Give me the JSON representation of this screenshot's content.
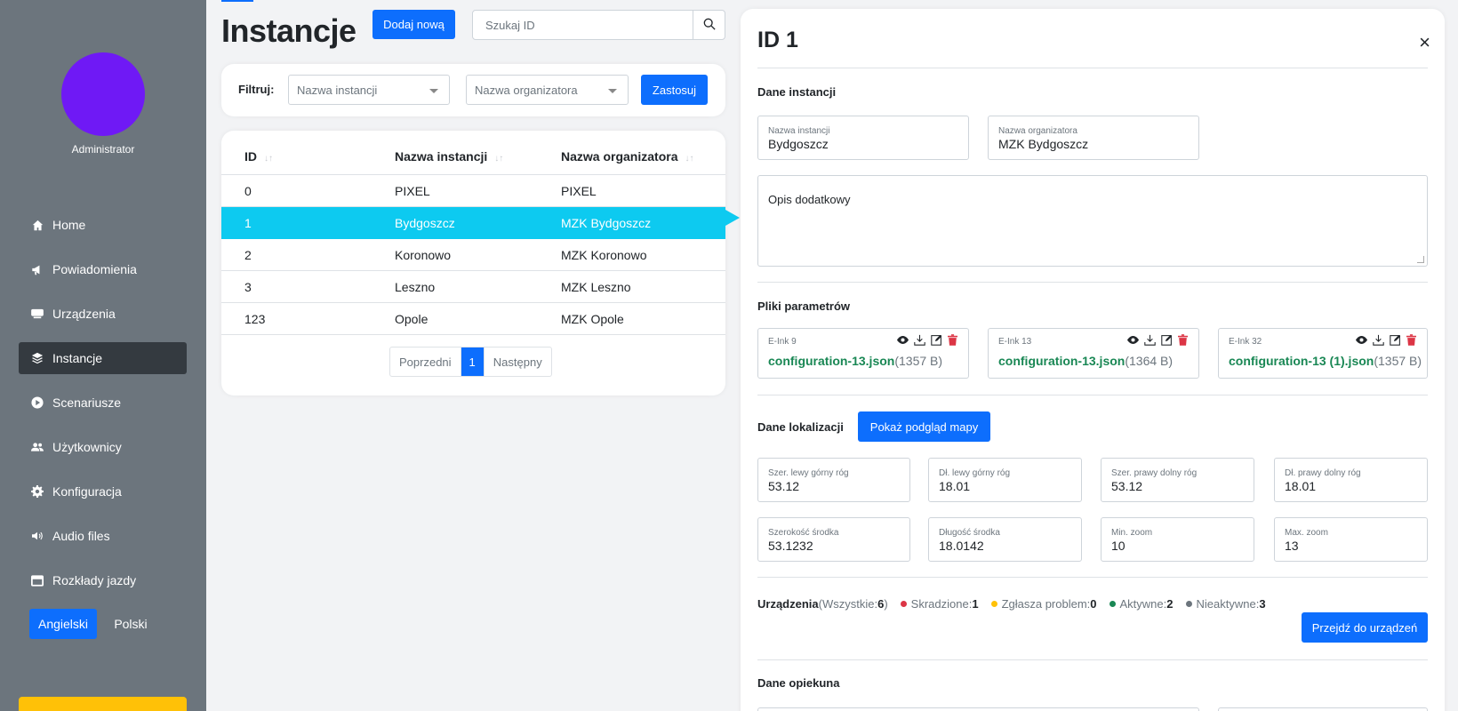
{
  "sidebar": {
    "role": "Administrator",
    "items": [
      {
        "label": "Home",
        "icon": "home-icon"
      },
      {
        "label": "Powiadomienia",
        "icon": "megaphone-icon"
      },
      {
        "label": "Urządzenia",
        "icon": "monitor-icon"
      },
      {
        "label": "Instancje",
        "icon": "layers-icon"
      },
      {
        "label": "Scenariusze",
        "icon": "play-circle-icon"
      },
      {
        "label": "Użytkownicy",
        "icon": "users-icon"
      },
      {
        "label": "Konfiguracja",
        "icon": "gear-icon"
      },
      {
        "label": "Audio files",
        "icon": "speaker-icon"
      },
      {
        "label": "Rozkłady jazdy",
        "icon": "schedule-icon"
      }
    ],
    "active_item": "Instancje",
    "lang_en": "Angielski",
    "lang_pl": "Polski",
    "avatar_color": "#6f19f5"
  },
  "header": {
    "title": "Instancje",
    "add_button": "Dodaj nową",
    "search_placeholder": "Szukaj ID"
  },
  "filter": {
    "label": "Filtruj:",
    "instance_placeholder": "Nazwa instancji",
    "organizer_placeholder": "Nazwa organizatora",
    "apply_button": "Zastosuj"
  },
  "table": {
    "headers": [
      "ID",
      "Nazwa instancji",
      "Nazwa organizatora"
    ],
    "rows": [
      {
        "id": "0",
        "name": "PIXEL",
        "org": "PIXEL"
      },
      {
        "id": "1",
        "name": "Bydgoszcz",
        "org": "MZK Bydgoszcz"
      },
      {
        "id": "2",
        "name": "Koronowo",
        "org": "MZK Koronowo"
      },
      {
        "id": "3",
        "name": "Leszno",
        "org": "MZK Leszno"
      },
      {
        "id": "123",
        "name": "Opole",
        "org": "MZK Opole"
      }
    ],
    "selected_row": 1,
    "pager": {
      "prev": "Poprzedni",
      "current": "1",
      "next": "Następny"
    }
  },
  "detail": {
    "title": "ID 1",
    "close": "×",
    "instance_section": "Dane instancji",
    "instance_name_label": "Nazwa instancji",
    "instance_name": "Bydgoszcz",
    "organizer_label": "Nazwa organizatora",
    "organizer": "MZK Bydgoszcz",
    "description_placeholder": "Opis dodatkowy",
    "files_section": "Pliki parametrów",
    "files": [
      {
        "device": "E-Ink 9",
        "file": "configuration-13.json",
        "size": "(1357 B)"
      },
      {
        "device": "E-Ink 13",
        "file": "configuration-13.json",
        "size": "(1364 B)"
      },
      {
        "device": "E-Ink 32",
        "file": "configuration-13 (1).json",
        "size": "(1357 B)"
      }
    ],
    "location_section": "Dane lokalizacji",
    "map_button": "Pokaż podgląd mapy",
    "location_fields": [
      {
        "label": "Szer. lewy górny róg",
        "value": "53.12"
      },
      {
        "label": "Dł. lewy górny róg",
        "value": "18.01"
      },
      {
        "label": "Szer. prawy dolny róg",
        "value": "53.12"
      },
      {
        "label": "Dł. prawy dolny róg",
        "value": "18.01"
      },
      {
        "label": "Szerokość środka",
        "value": "53.1232"
      },
      {
        "label": "Długość środka",
        "value": "18.0142"
      },
      {
        "label": "Min. zoom",
        "value": "10"
      },
      {
        "label": "Max. zoom",
        "value": "13"
      }
    ],
    "devices": {
      "title": "Urządzenia",
      "all_label": "(Wszystkie: ",
      "all_count": "6",
      "all_close": ")",
      "stolen_label": "Skradzione: ",
      "stolen_count": "1",
      "problem_label": "Zgłasza problem: ",
      "problem_count": "0",
      "active_label": "Aktywne: ",
      "active_count": "2",
      "inactive_label": "Nieaktywne: ",
      "inactive_count": "3",
      "button": "Przejdź do urządzeń",
      "colors": {
        "stolen": "#dc3545",
        "problem": "#ffc107",
        "active": "#198754",
        "inactive": "#6c757d"
      }
    },
    "caretaker_section": "Dane opiekuna"
  },
  "colors": {
    "primary": "#0d6efd",
    "selected_row": "#0dcaf0",
    "sidebar": "#6c757d",
    "link_green": "#198754"
  }
}
